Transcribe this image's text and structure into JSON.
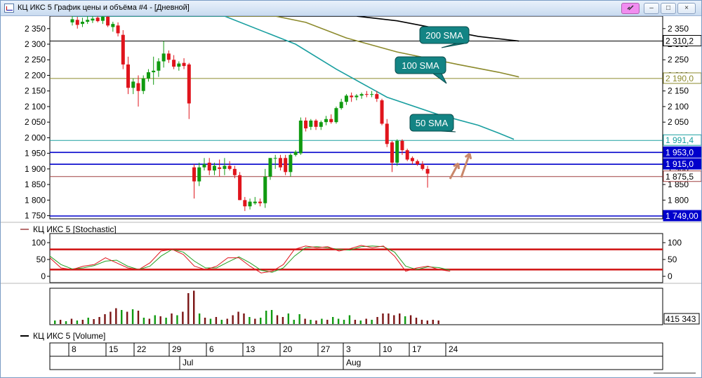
{
  "window": {
    "title": "КЦ ИКС 5 График цены и объёма #4 - [Дневной]"
  },
  "icons": {
    "app": "chart-window-icon",
    "link": "link-icon",
    "minimize": "minimize-icon",
    "maximize": "maximize-icon",
    "close": "close-icon"
  },
  "window_buttons": {
    "minimize": "–",
    "maximize": "□",
    "close": "×"
  },
  "colors": {
    "up_candle": "#109a10",
    "down_candle": "#e0141c",
    "sma50": "#1a9fa0",
    "sma100": "#8c8a2c",
    "sma200": "#000000",
    "support_blue": "#0000cc",
    "stoch_main": "#e0141c",
    "stoch_signal": "#20a020",
    "volume_up": "#109a10",
    "volume_down": "#7a1414",
    "callout_fill": "#138484",
    "arrow": "#c9876a"
  },
  "price_panel": {
    "y_ticks": [
      "1 750",
      "1 800",
      "1 850",
      "1 900",
      "1 950",
      "2 000",
      "2 050",
      "2 100",
      "2 150",
      "2 200",
      "2 250",
      "2 300",
      "2 350"
    ],
    "right_ticks": [
      "1 800",
      "1 850",
      "1 900",
      "1 950",
      "2 000",
      "2 050",
      "2 100",
      "2 150",
      "2 200",
      "2 250",
      "2 300",
      "2 350"
    ],
    "level_labels": [
      "2 310,2",
      "2 190,0",
      "1 991,4",
      "1 953,0",
      "1 915,0",
      "1 875,5",
      "1 749,00"
    ],
    "callouts": [
      "200 SMA",
      "100 SMA",
      "50 SMA"
    ]
  },
  "stochastic_panel": {
    "legend": "КЦ ИКС 5 [Stochastic]",
    "left_ticks": [
      "100",
      "50",
      "0"
    ],
    "right_ticks": [
      "100",
      "50",
      "0"
    ]
  },
  "volume_panel": {
    "legend": "КЦ ИКС 5 [Volume]",
    "last_value": "415 343"
  },
  "x_axis": {
    "day_labels": [
      "8",
      "15",
      "22",
      "29",
      "6",
      "13",
      "20",
      "27",
      "3",
      "10",
      "17",
      "24"
    ],
    "month_labels": [
      "Jul",
      "Aug"
    ]
  },
  "chart_data": [
    {
      "type": "candlestick",
      "panel": "price",
      "title": "",
      "ylim": [
        1740,
        2390
      ],
      "y_axis_side": "both",
      "grid": false,
      "days": [
        "8",
        "15",
        "22",
        "29",
        "6",
        "13",
        "20",
        "27",
        "3",
        "10",
        "17",
        "24"
      ],
      "candles": [
        {
          "o": 2370,
          "h": 2395,
          "l": 2360,
          "c": 2380
        },
        {
          "o": 2378,
          "h": 2388,
          "l": 2350,
          "c": 2362
        },
        {
          "o": 2365,
          "h": 2385,
          "l": 2355,
          "c": 2372
        },
        {
          "o": 2372,
          "h": 2390,
          "l": 2365,
          "c": 2378
        },
        {
          "o": 2376,
          "h": 2395,
          "l": 2368,
          "c": 2382
        },
        {
          "o": 2385,
          "h": 2392,
          "l": 2370,
          "c": 2374
        },
        {
          "o": 2375,
          "h": 2395,
          "l": 2365,
          "c": 2388
        },
        {
          "o": 2388,
          "h": 2392,
          "l": 2355,
          "c": 2360
        },
        {
          "o": 2355,
          "h": 2372,
          "l": 2340,
          "c": 2365
        },
        {
          "o": 2360,
          "h": 2370,
          "l": 2325,
          "c": 2335
        },
        {
          "o": 2330,
          "h": 2345,
          "l": 2220,
          "c": 2235
        },
        {
          "o": 2235,
          "h": 2260,
          "l": 2140,
          "c": 2160
        },
        {
          "o": 2160,
          "h": 2190,
          "l": 2140,
          "c": 2180
        },
        {
          "o": 2175,
          "h": 2200,
          "l": 2100,
          "c": 2150
        },
        {
          "o": 2150,
          "h": 2200,
          "l": 2140,
          "c": 2190
        },
        {
          "o": 2190,
          "h": 2220,
          "l": 2180,
          "c": 2210
        },
        {
          "o": 2210,
          "h": 2260,
          "l": 2170,
          "c": 2215
        },
        {
          "o": 2215,
          "h": 2255,
          "l": 2195,
          "c": 2245
        },
        {
          "o": 2245,
          "h": 2310,
          "l": 2225,
          "c": 2270
        },
        {
          "o": 2270,
          "h": 2280,
          "l": 2240,
          "c": 2250
        },
        {
          "o": 2250,
          "h": 2265,
          "l": 2220,
          "c": 2228
        },
        {
          "o": 2228,
          "h": 2245,
          "l": 2215,
          "c": 2238
        },
        {
          "o": 2240,
          "h": 2255,
          "l": 2220,
          "c": 2230
        },
        {
          "o": 2235,
          "h": 2240,
          "l": 2060,
          "c": 2110
        },
        {
          "o": 1905,
          "h": 1915,
          "l": 1805,
          "c": 1860
        },
        {
          "o": 1860,
          "h": 1920,
          "l": 1845,
          "c": 1905
        },
        {
          "o": 1905,
          "h": 1935,
          "l": 1895,
          "c": 1915
        },
        {
          "o": 1920,
          "h": 1935,
          "l": 1880,
          "c": 1895
        },
        {
          "o": 1895,
          "h": 1920,
          "l": 1880,
          "c": 1910
        },
        {
          "o": 1905,
          "h": 1930,
          "l": 1875,
          "c": 1900
        },
        {
          "o": 1900,
          "h": 1935,
          "l": 1880,
          "c": 1910
        },
        {
          "o": 1910,
          "h": 1925,
          "l": 1895,
          "c": 1900
        },
        {
          "o": 1900,
          "h": 1910,
          "l": 1870,
          "c": 1880
        },
        {
          "o": 1880,
          "h": 1890,
          "l": 1800,
          "c": 1800
        },
        {
          "o": 1800,
          "h": 1810,
          "l": 1765,
          "c": 1780
        },
        {
          "o": 1780,
          "h": 1805,
          "l": 1770,
          "c": 1795
        },
        {
          "o": 1790,
          "h": 1810,
          "l": 1785,
          "c": 1795
        },
        {
          "o": 1795,
          "h": 1805,
          "l": 1780,
          "c": 1790
        },
        {
          "o": 1790,
          "h": 1900,
          "l": 1775,
          "c": 1875
        },
        {
          "o": 1875,
          "h": 1935,
          "l": 1865,
          "c": 1935
        },
        {
          "o": 1935,
          "h": 1945,
          "l": 1900,
          "c": 1935
        },
        {
          "o": 1935,
          "h": 1945,
          "l": 1895,
          "c": 1905
        },
        {
          "o": 1935,
          "h": 1945,
          "l": 1880,
          "c": 1890
        },
        {
          "o": 1890,
          "h": 1950,
          "l": 1875,
          "c": 1945
        },
        {
          "o": 1945,
          "h": 1960,
          "l": 1940,
          "c": 1955
        },
        {
          "o": 1950,
          "h": 2065,
          "l": 1945,
          "c": 2055
        },
        {
          "o": 2055,
          "h": 2065,
          "l": 2020,
          "c": 2030
        },
        {
          "o": 2035,
          "h": 2060,
          "l": 2025,
          "c": 2055
        },
        {
          "o": 2055,
          "h": 2060,
          "l": 2025,
          "c": 2035
        },
        {
          "o": 2035,
          "h": 2055,
          "l": 2025,
          "c": 2050
        },
        {
          "o": 2050,
          "h": 2070,
          "l": 2040,
          "c": 2060
        },
        {
          "o": 2060,
          "h": 2075,
          "l": 2045,
          "c": 2050
        },
        {
          "o": 2050,
          "h": 2100,
          "l": 2045,
          "c": 2095
        },
        {
          "o": 2095,
          "h": 2125,
          "l": 2090,
          "c": 2115
        },
        {
          "o": 2115,
          "h": 2140,
          "l": 2105,
          "c": 2135
        },
        {
          "o": 2135,
          "h": 2145,
          "l": 2115,
          "c": 2130
        },
        {
          "o": 2130,
          "h": 2140,
          "l": 2120,
          "c": 2135
        },
        {
          "o": 2135,
          "h": 2145,
          "l": 2125,
          "c": 2140
        },
        {
          "o": 2140,
          "h": 2150,
          "l": 2130,
          "c": 2138
        },
        {
          "o": 2140,
          "h": 2150,
          "l": 2130,
          "c": 2140
        },
        {
          "o": 2140,
          "h": 2150,
          "l": 2115,
          "c": 2125
        },
        {
          "o": 2120,
          "h": 2125,
          "l": 2040,
          "c": 2045
        },
        {
          "o": 2045,
          "h": 2060,
          "l": 1970,
          "c": 1980
        },
        {
          "o": 1985,
          "h": 1990,
          "l": 1890,
          "c": 1920
        },
        {
          "o": 1920,
          "h": 1995,
          "l": 1910,
          "c": 1990
        },
        {
          "o": 1990,
          "h": 1995,
          "l": 1945,
          "c": 1960
        },
        {
          "o": 1960,
          "h": 1965,
          "l": 1925,
          "c": 1930
        },
        {
          "o": 1935,
          "h": 1940,
          "l": 1915,
          "c": 1925
        },
        {
          "o": 1925,
          "h": 1930,
          "l": 1910,
          "c": 1915
        },
        {
          "o": 1915,
          "h": 1925,
          "l": 1895,
          "c": 1900
        },
        {
          "o": 1900,
          "h": 1910,
          "l": 1840,
          "c": 1885
        }
      ],
      "sma50": [
        [
          0,
          2390
        ],
        [
          30,
          2390
        ],
        [
          44,
          2300
        ],
        [
          52,
          2220
        ],
        [
          62,
          2130
        ],
        [
          72,
          2075
        ],
        [
          80,
          2040
        ],
        [
          84,
          2015
        ],
        [
          87,
          1995
        ]
      ],
      "sma100": [
        [
          0,
          2390
        ],
        [
          40,
          2390
        ],
        [
          46,
          2370
        ],
        [
          54,
          2320
        ],
        [
          64,
          2275
        ],
        [
          76,
          2235
        ],
        [
          84,
          2210
        ],
        [
          88,
          2195
        ]
      ],
      "sma200": [
        [
          0,
          2390
        ],
        [
          56,
          2390
        ],
        [
          64,
          2375
        ],
        [
          72,
          2350
        ],
        [
          80,
          2325
        ],
        [
          88,
          2310
        ]
      ],
      "horizontal_levels": [
        {
          "value": 2310.2,
          "color": "#000000"
        },
        {
          "value": 2190.0,
          "color": "#8c8a2c"
        },
        {
          "value": 1991.4,
          "color": "#1a9fa0"
        },
        {
          "value": 1953.0,
          "color": "#0000cc"
        },
        {
          "value": 1915.0,
          "color": "#0000cc"
        },
        {
          "value": 1875.5,
          "color": "#a04040"
        },
        {
          "value": 1749.0,
          "color": "#0000cc"
        }
      ]
    },
    {
      "type": "line",
      "panel": "stochastic",
      "title": "",
      "ylim": [
        -10,
        110
      ],
      "levels": [
        80,
        20
      ],
      "main": [
        [
          0,
          55
        ],
        [
          3,
          25
        ],
        [
          6,
          20
        ],
        [
          9,
          30
        ],
        [
          12,
          35
        ],
        [
          15,
          55
        ],
        [
          18,
          40
        ],
        [
          21,
          25
        ],
        [
          24,
          20
        ],
        [
          27,
          40
        ],
        [
          30,
          75
        ],
        [
          33,
          80
        ],
        [
          36,
          65
        ],
        [
          39,
          30
        ],
        [
          42,
          20
        ],
        [
          45,
          30
        ],
        [
          48,
          55
        ],
        [
          51,
          55
        ],
        [
          54,
          30
        ],
        [
          57,
          10
        ],
        [
          60,
          15
        ],
        [
          63,
          35
        ],
        [
          66,
          80
        ],
        [
          69,
          90
        ],
        [
          72,
          85
        ],
        [
          75,
          88
        ],
        [
          78,
          75
        ],
        [
          81,
          82
        ],
        [
          84,
          92
        ],
        [
          87,
          85
        ],
        [
          90,
          90
        ],
        [
          93,
          60
        ],
        [
          96,
          15
        ],
        [
          99,
          25
        ],
        [
          102,
          30
        ],
        [
          105,
          20
        ],
        [
          108,
          15
        ]
      ],
      "signal": [
        [
          0,
          60
        ],
        [
          3,
          35
        ],
        [
          6,
          22
        ],
        [
          9,
          25
        ],
        [
          12,
          32
        ],
        [
          15,
          45
        ],
        [
          18,
          48
        ],
        [
          21,
          30
        ],
        [
          24,
          20
        ],
        [
          27,
          30
        ],
        [
          30,
          60
        ],
        [
          33,
          80
        ],
        [
          36,
          72
        ],
        [
          39,
          45
        ],
        [
          42,
          25
        ],
        [
          45,
          25
        ],
        [
          48,
          42
        ],
        [
          51,
          58
        ],
        [
          54,
          40
        ],
        [
          57,
          18
        ],
        [
          60,
          12
        ],
        [
          63,
          25
        ],
        [
          66,
          60
        ],
        [
          69,
          85
        ],
        [
          72,
          88
        ],
        [
          75,
          85
        ],
        [
          78,
          80
        ],
        [
          81,
          78
        ],
        [
          84,
          88
        ],
        [
          87,
          90
        ],
        [
          90,
          88
        ],
        [
          93,
          72
        ],
        [
          96,
          30
        ],
        [
          99,
          20
        ],
        [
          102,
          28
        ],
        [
          105,
          26
        ],
        [
          108,
          18
        ]
      ]
    },
    {
      "type": "bar",
      "panel": "volume",
      "title": "",
      "last_value": 415343,
      "values": [
        {
          "v": 0.1,
          "up": true
        },
        {
          "v": 0.12,
          "up": false
        },
        {
          "v": 0.08,
          "up": true
        },
        {
          "v": 0.15,
          "up": false
        },
        {
          "v": 0.1,
          "up": true
        },
        {
          "v": 0.12,
          "up": false
        },
        {
          "v": 0.18,
          "up": true
        },
        {
          "v": 0.14,
          "up": false
        },
        {
          "v": 0.2,
          "up": false
        },
        {
          "v": 0.28,
          "up": false
        },
        {
          "v": 0.35,
          "up": false
        },
        {
          "v": 0.45,
          "up": false
        },
        {
          "v": 0.4,
          "up": true
        },
        {
          "v": 0.35,
          "up": false
        },
        {
          "v": 0.42,
          "up": true
        },
        {
          "v": 0.38,
          "up": false
        },
        {
          "v": 0.18,
          "up": true
        },
        {
          "v": 0.15,
          "up": false
        },
        {
          "v": 0.25,
          "up": true
        },
        {
          "v": 0.22,
          "up": false
        },
        {
          "v": 0.18,
          "up": true
        },
        {
          "v": 0.3,
          "up": false
        },
        {
          "v": 0.25,
          "up": true
        },
        {
          "v": 0.35,
          "up": false
        },
        {
          "v": 0.88,
          "up": false
        },
        {
          "v": 0.95,
          "up": false
        },
        {
          "v": 0.3,
          "up": true
        },
        {
          "v": 0.18,
          "up": false
        },
        {
          "v": 0.15,
          "up": true
        },
        {
          "v": 0.2,
          "up": false
        },
        {
          "v": 0.12,
          "up": true
        },
        {
          "v": 0.15,
          "up": false
        },
        {
          "v": 0.25,
          "up": false
        },
        {
          "v": 0.35,
          "up": false
        },
        {
          "v": 0.3,
          "up": false
        },
        {
          "v": 0.2,
          "up": true
        },
        {
          "v": 0.15,
          "up": false
        },
        {
          "v": 0.18,
          "up": true
        },
        {
          "v": 0.38,
          "up": true
        },
        {
          "v": 0.4,
          "up": true
        },
        {
          "v": 0.25,
          "up": false
        },
        {
          "v": 0.2,
          "up": false
        },
        {
          "v": 0.3,
          "up": true
        },
        {
          "v": 0.12,
          "up": true
        },
        {
          "v": 0.28,
          "up": true
        },
        {
          "v": 0.15,
          "up": false
        },
        {
          "v": 0.12,
          "up": true
        },
        {
          "v": 0.1,
          "up": false
        },
        {
          "v": 0.15,
          "up": true
        },
        {
          "v": 0.12,
          "up": false
        },
        {
          "v": 0.2,
          "up": true
        },
        {
          "v": 0.15,
          "up": true
        },
        {
          "v": 0.12,
          "up": true
        },
        {
          "v": 0.25,
          "up": true
        },
        {
          "v": 0.12,
          "up": false
        },
        {
          "v": 0.1,
          "up": true
        },
        {
          "v": 0.15,
          "up": false
        },
        {
          "v": 0.12,
          "up": true
        },
        {
          "v": 0.2,
          "up": false
        },
        {
          "v": 0.3,
          "up": false
        },
        {
          "v": 0.3,
          "up": false
        },
        {
          "v": 0.25,
          "up": false
        },
        {
          "v": 0.3,
          "up": false
        },
        {
          "v": 0.22,
          "up": true
        },
        {
          "v": 0.25,
          "up": false
        },
        {
          "v": 0.18,
          "up": false
        },
        {
          "v": 0.12,
          "up": false
        },
        {
          "v": 0.1,
          "up": false
        },
        {
          "v": 0.12,
          "up": false
        },
        {
          "v": 0.1,
          "up": false
        }
      ]
    }
  ]
}
